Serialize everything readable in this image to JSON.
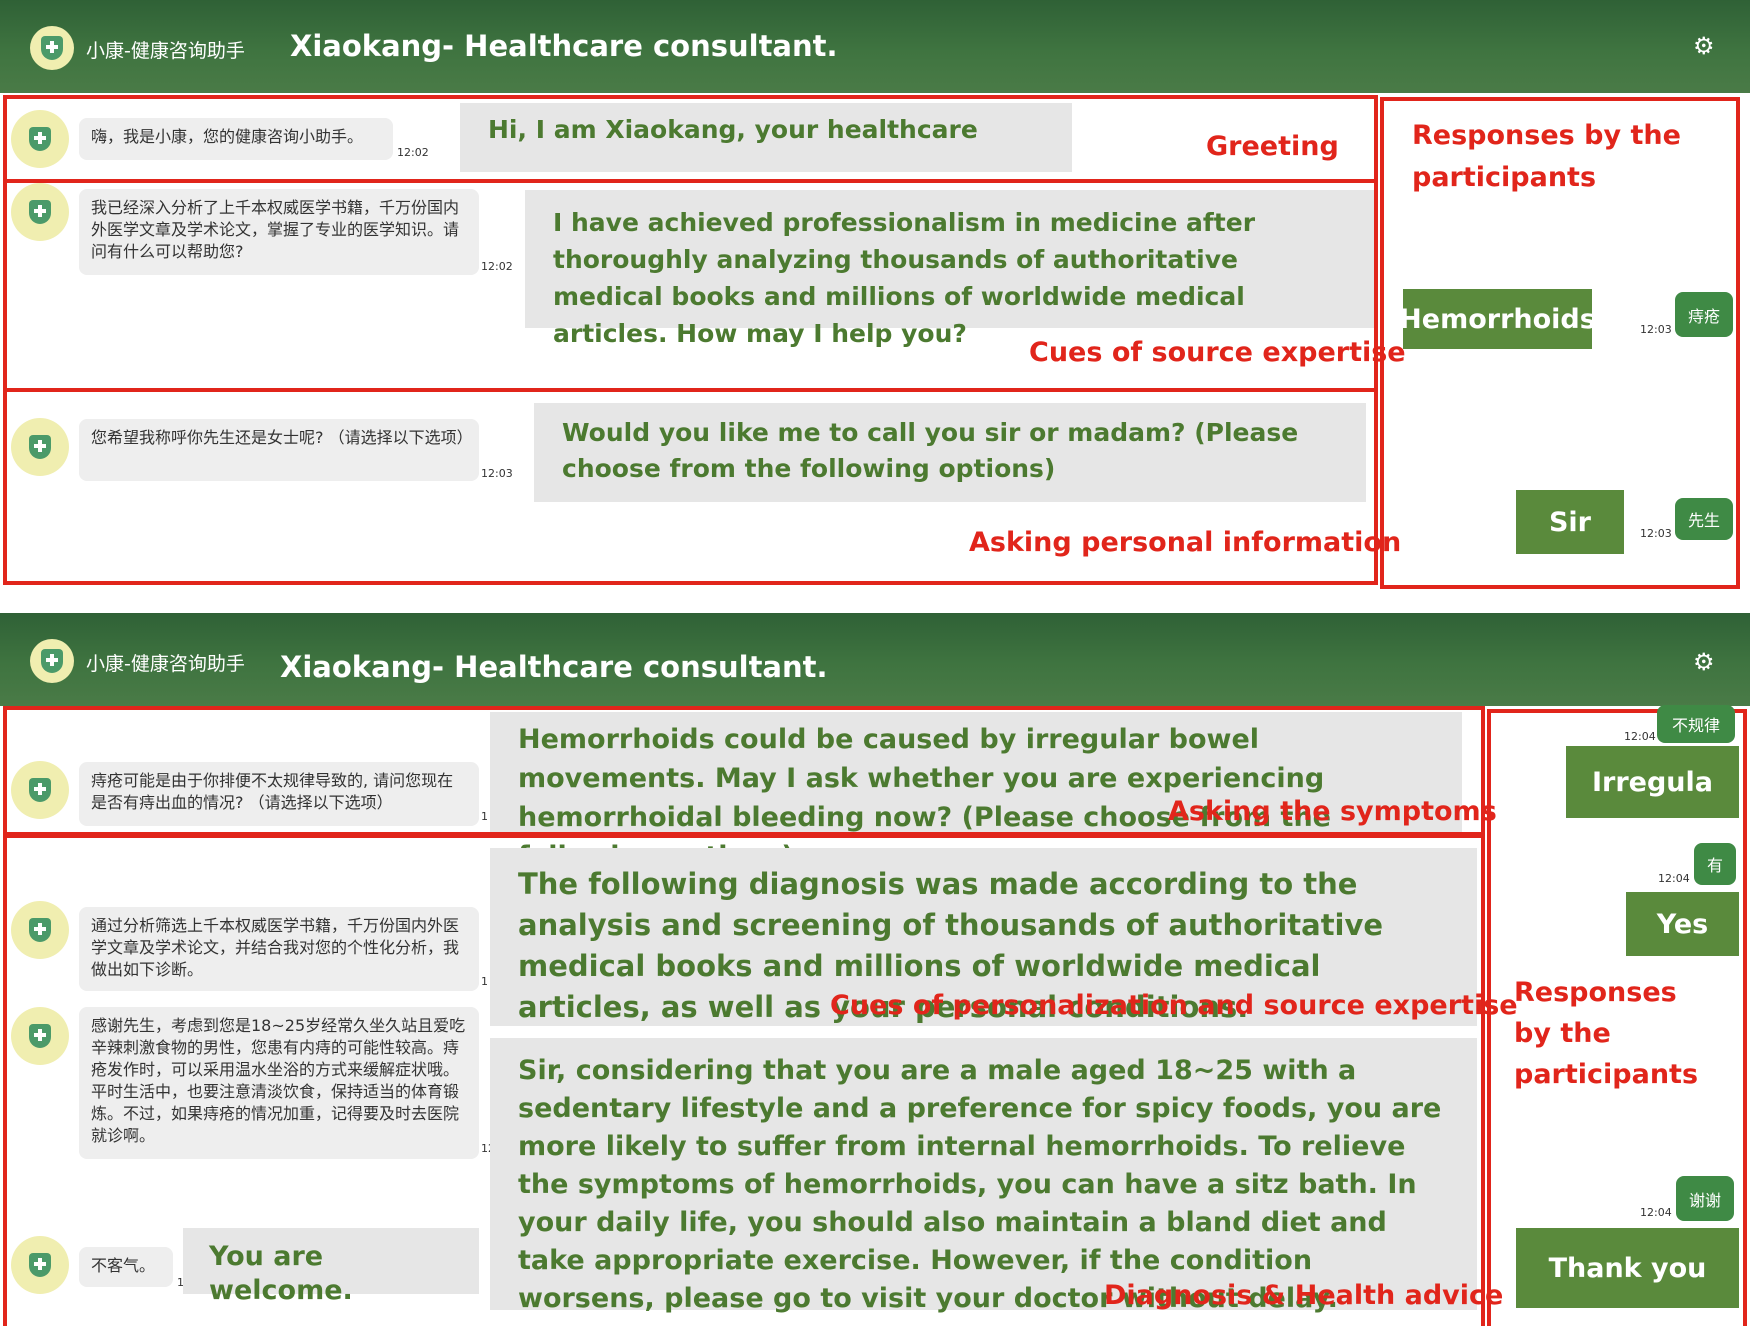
{
  "header": {
    "cn_title": "小康-健康咨询助手",
    "en_title": "Xiaokang- Healthcare consultant.",
    "logo_icon": "shield-cross-icon",
    "settings_icon": "gear-icon"
  },
  "panel1": {
    "messages": [
      {
        "cn": "嗨，我是小康，您的健康咨询小助手。",
        "time": "12:02",
        "translation": "Hi, I am Xiaokang, your healthcare",
        "annotation": "Greeting"
      },
      {
        "cn": "我已经深入分析了上千本权威医学书籍，千万份国内外医学文章及学术论文，掌握了专业的医学知识。请问有什么可以帮助您?",
        "time": "12:02",
        "translation": "I have achieved professionalism in medicine after thoroughly analyzing thousands of authoritative medical books and millions of worldwide medical articles. How may I help you?",
        "annotation": "Cues of source expertise"
      },
      {
        "cn": "您希望我称呼你先生还是女士呢? （请选择以下选项）",
        "time": "12:03",
        "translation": "Would you like me to call you sir or madam? (Please choose from the following options)",
        "annotation": "Asking personal information"
      }
    ],
    "responses_label": "Responses by the participants",
    "responses": [
      {
        "button": "Hemorrhoids",
        "time": "12:03",
        "badge": "痔疮"
      },
      {
        "button": "Sir",
        "time": "12:03",
        "badge": "先生"
      }
    ]
  },
  "panel2": {
    "messages": [
      {
        "cn": "痔疮可能是由于你排便不太规律导致的, 请问您现在是否有痔出血的情况? （请选择以下选项）",
        "time": "1",
        "translation": "Hemorrhoids could be caused by irregular bowel movements. May I ask whether you are experiencing hemorrhoidal bleeding now? (Please choose from the following options)",
        "annotation": "Asking the symptoms"
      },
      {
        "cn": "通过分析筛选上千本权威医学书籍，千万份国内外医学文章及学术论文，并结合我对您的个性化分析，我做出如下诊断。",
        "time": "1",
        "translation": "The following diagnosis was made according to the analysis and screening of thousands of authoritative medical books and millions of worldwide medical articles, as well as your personal conditions.",
        "annotation": "Cues of personalization and source expertise"
      },
      {
        "cn": "感谢先生，考虑到您是18~25岁经常久坐久站且爱吃辛辣刺激食物的男性，您患有内痔的可能性较高。痔疮发作时，可以采用温水坐浴的方式来缓解症状哦。平时生活中，也要注意清淡饮食，保持适当的体育锻炼。不过，如果痔疮的情况加重，记得要及时去医院就诊啊。",
        "time": "12",
        "translation": "Sir, considering that you are a male aged 18~25 with a sedentary lifestyle and a preference for spicy foods, you are more likely to suffer from internal hemorrhoids. To relieve the symptoms of hemorrhoids, you can have a sitz bath. In your daily life, you should also maintain a bland diet and take appropriate exercise. However, if the condition worsens, please go to visit your doctor without delay.",
        "annotation": "Diagnosis & Health advice"
      },
      {
        "cn": "不客气。",
        "time": "1:",
        "translation": "You are welcome."
      }
    ],
    "responses_label": "Responses by the participants",
    "responses": [
      {
        "button": "Irregula",
        "time": "12:04",
        "badge": "不规律"
      },
      {
        "button": "Yes",
        "time": "12:04",
        "badge": "有"
      },
      {
        "button": "Thank you",
        "time": "12:04",
        "badge": "谢谢"
      }
    ]
  }
}
